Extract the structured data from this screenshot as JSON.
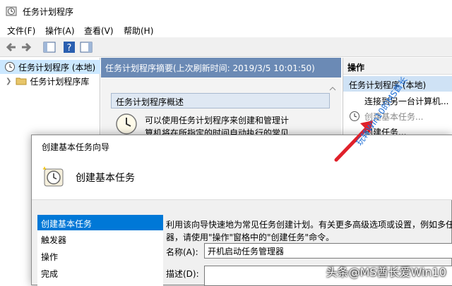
{
  "window": {
    "title": "任务计划程序"
  },
  "menubar": {
    "items": [
      "文件(F)",
      "操作(A)",
      "查看(V)",
      "帮助(H)"
    ]
  },
  "tree": {
    "items": [
      {
        "label": "任务计划程序 (本地)",
        "selected": true
      },
      {
        "label": "任务计划程序库",
        "selected": false
      }
    ]
  },
  "center": {
    "header": "任务计划程序摘要(上次刷新时间: 2019/3/5 10:01:50)",
    "overview_title": "任务计划程序概述",
    "overview_text_line1": "可以使用任务计划程序来创建和管理计",
    "overview_text_line2": "算机将在所指定的时间自动执行的常见"
  },
  "actions": {
    "header": "操作",
    "section": "任务计划程序 (本地)",
    "items": [
      "连接到另一台计算机...",
      "创建基本任务...",
      "创建任务..."
    ]
  },
  "dialog": {
    "title": "创建基本任务向导",
    "heading": "创建基本任务",
    "steps": [
      "创建基本任务",
      "触发器",
      "操作",
      "完成"
    ],
    "description_line1": "利用该向导快速地为常见任务创建计划。有关更多高级选项或设置，例如多任",
    "description_line2": "器，请使用\"操作\"窗格中的\"创建任务\"命令。",
    "name_label": "名称(A):",
    "name_value": "开机启动任务管理器",
    "desc_label": "描述(D):"
  },
  "watermarks": {
    "bottom": "头条@MS酋长爱Win10",
    "diagonal": "玩转Win10的MS酋长"
  },
  "colors": {
    "accent": "#0078d7",
    "header": "#6b8ab5",
    "arrow": "#e0202a"
  }
}
